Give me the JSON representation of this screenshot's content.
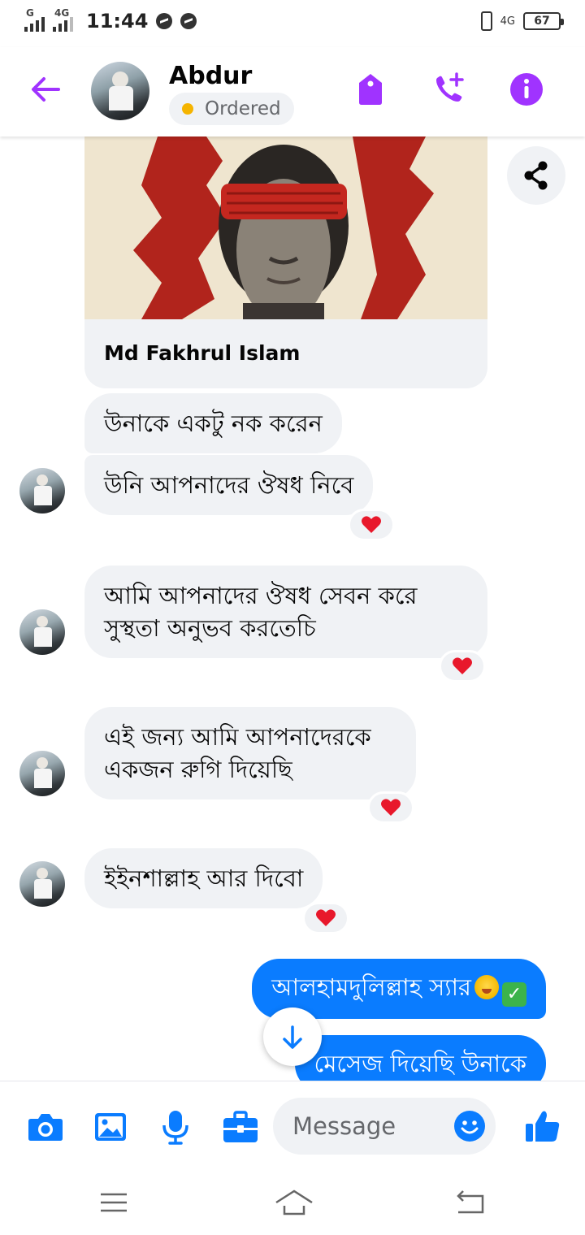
{
  "status_bar": {
    "network_left": "G",
    "network_left_2": "4G",
    "time": "11:44",
    "network_right": "4G",
    "battery": "67"
  },
  "header": {
    "contact_name": "Abdur",
    "status_label": "Ordered",
    "status_color": "#f5b400",
    "accent_color": "#a033ff",
    "icons": [
      "back-arrow-icon",
      "tag-icon",
      "add-call-icon",
      "info-icon"
    ]
  },
  "chat": {
    "shared_card": {
      "title": "Md Fakhrul Islam"
    },
    "messages": [
      {
        "direction": "incoming",
        "text": "উনাকে একটু নক করেন",
        "reaction": ""
      },
      {
        "direction": "incoming",
        "text": "উনি আপনাদের ঔষধ নিবে",
        "reaction": "❤"
      },
      {
        "direction": "incoming",
        "text": "আমি আপনাদের ঔষধ সেবন করে\nসুস্থতা  অনুভব  করতেচি",
        "reaction": "❤"
      },
      {
        "direction": "incoming",
        "text": "এই জন্য আমি আপনাদেরকে\nএকজন রুগি দিয়েছি",
        "reaction": "❤"
      },
      {
        "direction": "incoming",
        "text": "ইইনশাল্লাহ  আর দিবো",
        "reaction": "❤"
      },
      {
        "direction": "outgoing",
        "text": "আলহামদুলিল্লাহ স্যার",
        "emojis": [
          "hugging-face",
          "check-mark"
        ]
      },
      {
        "direction": "outgoing",
        "text": "মেসেজ দিয়েছি উনাকে"
      }
    ],
    "outgoing_color": "#0a7cff",
    "incoming_color": "#f0f2f5"
  },
  "composer": {
    "placeholder": "Message",
    "icons": [
      "camera-icon",
      "gallery-icon",
      "microphone-icon",
      "briefcase-icon",
      "emoji-icon",
      "thumbs-up-icon"
    ],
    "icon_color": "#0a7cff"
  },
  "nav": {
    "icons": [
      "menu-icon",
      "home-icon",
      "back-icon"
    ]
  }
}
